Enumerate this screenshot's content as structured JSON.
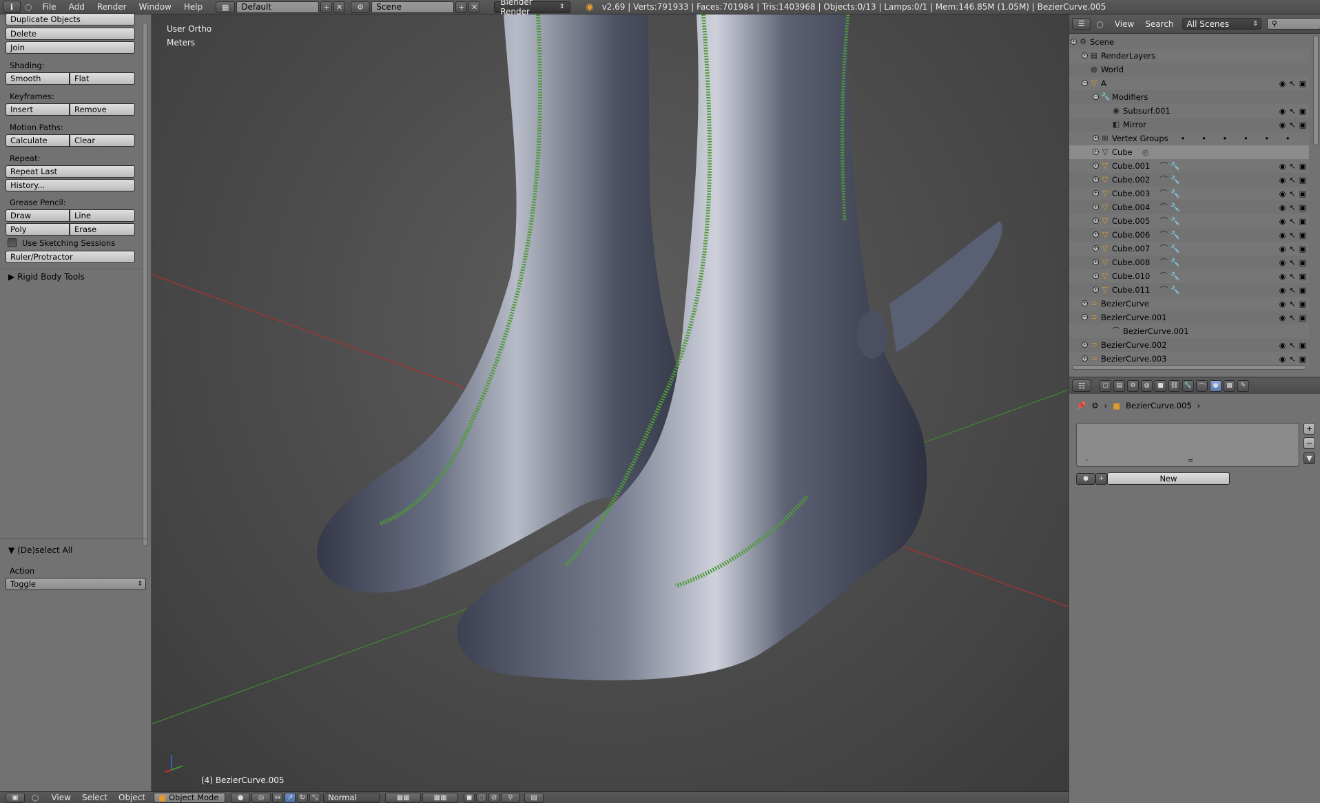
{
  "topbar": {
    "menus": [
      "File",
      "Add",
      "Render",
      "Window",
      "Help"
    ],
    "screen_layout": "Default",
    "scene": "Scene",
    "render_engine": "Blender Render",
    "stats": "v2.69 | Verts:791933 | Faces:701984 | Tris:1403968 | Objects:0/13 | Lamps:0/1 | Mem:146.85M (1.05M) | BezierCurve.005"
  },
  "toolshelf": {
    "duplicate": "Duplicate Objects",
    "delete": "Delete",
    "join": "Join",
    "shading_label": "Shading:",
    "smooth": "Smooth",
    "flat": "Flat",
    "keyframes_label": "Keyframes:",
    "insert": "Insert",
    "remove": "Remove",
    "motion_label": "Motion Paths:",
    "calculate": "Calculate",
    "clear": "Clear",
    "repeat_label": "Repeat:",
    "repeat_last": "Repeat Last",
    "history": "History...",
    "grease_label": "Grease Pencil:",
    "draw": "Draw",
    "line": "Line",
    "poly": "Poly",
    "erase": "Erase",
    "sketching": "Use Sketching Sessions",
    "ruler": "Ruler/Protractor",
    "rigid_body": "Rigid Body Tools",
    "operator_title": "(De)select All",
    "action_label": "Action",
    "action_value": "Toggle"
  },
  "viewport": {
    "view_name": "User Ortho",
    "units": "Meters",
    "active_object": "(4) BezierCurve.005"
  },
  "bottombar": {
    "menus": [
      "View",
      "Select",
      "Object"
    ],
    "mode": "Object Mode",
    "orientation": "Normal"
  },
  "outliner": {
    "menus": [
      "View",
      "Search"
    ],
    "filter": "All Scenes",
    "rows": [
      {
        "label": "Scene",
        "icon": "scene-icon"
      },
      {
        "label": "RenderLayers",
        "icon": "renderlayers-icon"
      },
      {
        "label": "World",
        "icon": "world-icon"
      },
      {
        "label": "A",
        "icon": "mesh-icon"
      },
      {
        "label": "Modifiers",
        "icon": "wrench-icon"
      },
      {
        "label": "Subsurf.001",
        "icon": "subsurf-icon"
      },
      {
        "label": "Mirror",
        "icon": "mirror-icon"
      },
      {
        "label": "Vertex Groups",
        "icon": "vertexgroup-icon"
      },
      {
        "label": "Cube",
        "icon": "mesh-data-icon"
      },
      {
        "label": "Cube.001",
        "icon": "mesh-icon"
      },
      {
        "label": "Cube.002",
        "icon": "mesh-icon"
      },
      {
        "label": "Cube.003",
        "icon": "mesh-icon"
      },
      {
        "label": "Cube.004",
        "icon": "mesh-icon"
      },
      {
        "label": "Cube.005",
        "icon": "mesh-icon"
      },
      {
        "label": "Cube.006",
        "icon": "mesh-icon"
      },
      {
        "label": "Cube.007",
        "icon": "mesh-icon"
      },
      {
        "label": "Cube.008",
        "icon": "mesh-icon"
      },
      {
        "label": "Cube.010",
        "icon": "mesh-icon"
      },
      {
        "label": "Cube.011",
        "icon": "mesh-icon"
      },
      {
        "label": "BezierCurve",
        "icon": "curve-icon"
      },
      {
        "label": "BezierCurve.001",
        "icon": "curve-icon"
      },
      {
        "label": "BezierCurve.001",
        "icon": "curve-data-icon"
      },
      {
        "label": "BezierCurve.002",
        "icon": "curve-icon"
      },
      {
        "label": "BezierCurve.003",
        "icon": "curve-icon"
      }
    ]
  },
  "properties": {
    "breadcrumb": "BezierCurve.005",
    "new_button": "New"
  },
  "colors": {
    "panel_bg": "#727272",
    "header_bg": "#555555",
    "mesh_icon": "#e39a2b",
    "curve_icon": "#e39a2b",
    "active_tab": "#6a8ac0",
    "grid_x_axis": "#c83232",
    "grid_y_axis": "#4f9a3a"
  }
}
